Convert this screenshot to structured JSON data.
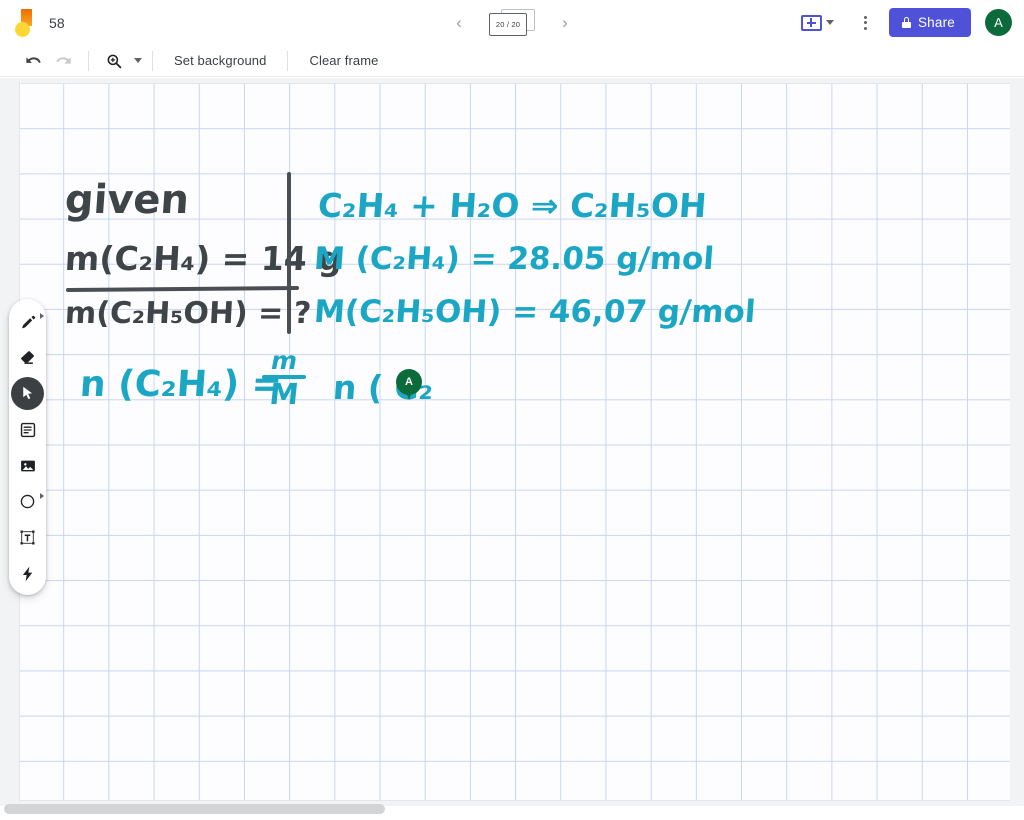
{
  "app": {
    "logo_icon": "jamboard-logo",
    "document_title": "58"
  },
  "topbar": {
    "prev_frame_icon": "chevron-left-icon",
    "next_frame_icon": "chevron-right-icon",
    "frame_counter": "20 / 20",
    "add_frame_icon": "add-frame-icon",
    "add_frame_caret_icon": "chevron-down-icon",
    "more_menu_icon": "kebab-menu-icon",
    "share_label": "Share",
    "share_lock_icon": "lock-icon",
    "share_color": "#4f52d8",
    "avatar_initial": "A",
    "avatar_color": "#0b6b3a"
  },
  "subtoolbar": {
    "undo_icon": "undo-icon",
    "redo_icon": "redo-icon",
    "zoom_icon": "zoom-magnifier-icon",
    "zoom_caret_icon": "chevron-down-icon",
    "set_background_label": "Set background",
    "clear_frame_label": "Clear frame"
  },
  "palette": {
    "tools": [
      {
        "name": "pen-tool",
        "icon": "pen-icon",
        "active": false,
        "has_submenu": true
      },
      {
        "name": "eraser-tool",
        "icon": "eraser-icon",
        "active": false,
        "has_submenu": false
      },
      {
        "name": "select-tool",
        "icon": "cursor-arrow-icon",
        "active": true,
        "has_submenu": false
      },
      {
        "name": "sticky-note-tool",
        "icon": "sticky-note-icon",
        "active": false,
        "has_submenu": false
      },
      {
        "name": "image-tool",
        "icon": "image-icon",
        "active": false,
        "has_submenu": false
      },
      {
        "name": "shape-tool",
        "icon": "circle-shape-icon",
        "active": true,
        "has_submenu": true
      },
      {
        "name": "text-box-tool",
        "icon": "text-box-icon",
        "active": false,
        "has_submenu": false
      },
      {
        "name": "laser-tool",
        "icon": "laser-pointer-icon",
        "active": false,
        "has_submenu": false
      }
    ]
  },
  "canvas": {
    "background": "grid-paper",
    "grid_color": "#c8d6f0",
    "paper_color": "#fdfdff",
    "ink_dark_color": "#3f4448",
    "ink_teal_color": "#1ba7c4",
    "handwriting": {
      "given_label": "given",
      "mass_ethene": "m(C₂H₄) = 14 g",
      "mass_ethanol": "m(C₂H₅OH) = ?",
      "reaction": "C₂H₄ + H₂O ⇒ C₂H₅OH",
      "molar_mass_ethene": "M (C₂H₄) = 28.05 g/mol",
      "molar_mass_ethanol": "M(C₂H₅OH) = 46,07 g/mol",
      "moles_formula_lhs": "n (C₂H₄) =",
      "fraction_numerator": "m",
      "fraction_denominator": "M",
      "moles_partial": "n ( C₂"
    },
    "collaborator_cursor": {
      "initial": "A",
      "color": "#0b6b3a"
    }
  },
  "scrollbar": {
    "horizontal_thumb": "h-scroll-thumb"
  }
}
